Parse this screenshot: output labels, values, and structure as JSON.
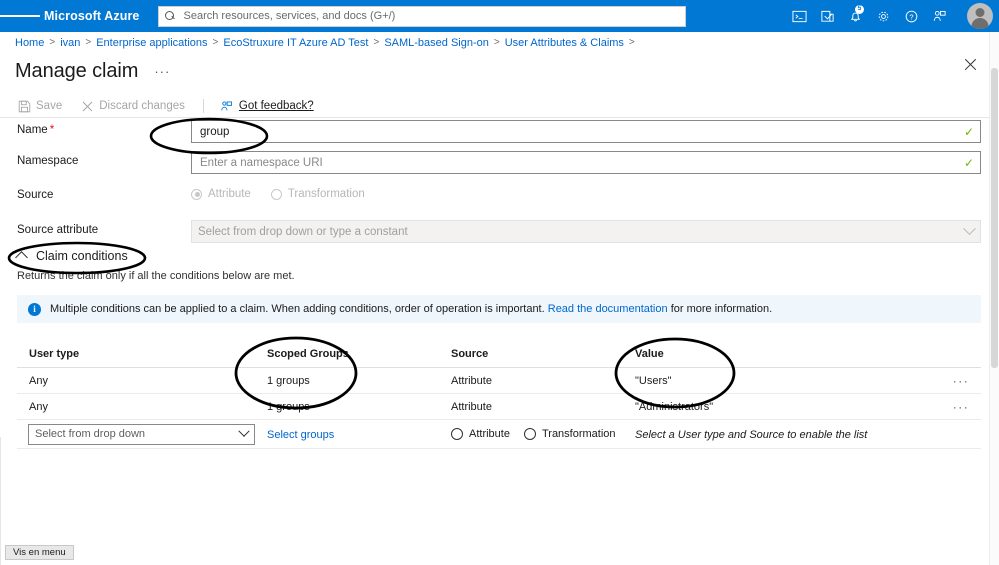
{
  "topbar": {
    "menu_icon": "hamburger-icon",
    "brand": "Microsoft Azure",
    "search": {
      "placeholder": "Search resources, services, and docs (G+/)",
      "value": "",
      "icon": "search-icon"
    },
    "icons": [
      {
        "name": "cloud-shell-icon",
        "glyph": ">_"
      },
      {
        "name": "directories-subscriptions-icon",
        "glyph": "directory"
      },
      {
        "name": "notifications-bell-icon",
        "glyph": "bell",
        "badge": "5"
      },
      {
        "name": "settings-gear-icon",
        "glyph": "gear"
      },
      {
        "name": "help-question-icon",
        "glyph": "?"
      },
      {
        "name": "feedback-person-icon",
        "glyph": "feedback"
      }
    ],
    "avatar": "user-avatar"
  },
  "breadcrumb": {
    "separator": ">",
    "items": [
      "Home",
      "ivan",
      "Enterprise applications",
      "EcoStruxure IT Azure AD Test",
      "SAML-based Sign-on",
      "User Attributes & Claims"
    ]
  },
  "header": {
    "title": "Manage claim",
    "more_label": "···",
    "close_label": "✕"
  },
  "toolbar": {
    "save_label": "Save",
    "discard_label": "Discard changes",
    "feedback_label": "Got feedback?"
  },
  "form": {
    "name": {
      "label": "Name",
      "required_mark": "*",
      "value": "group",
      "placeholder": "",
      "valid_mark": "✓"
    },
    "namespace": {
      "label": "Namespace",
      "value": "",
      "placeholder": "Enter a namespace URI",
      "valid_mark": "✓"
    },
    "source": {
      "label": "Source",
      "options": [
        "Attribute",
        "Transformation"
      ],
      "selected": "Attribute"
    },
    "source_attribute": {
      "label": "Source attribute",
      "placeholder": "Select from drop down or type a constant",
      "value": ""
    }
  },
  "claim_conditions": {
    "section_title": "Claim conditions",
    "section_subtitle": "Returns the claim only if all the conditions below are met.",
    "banner": {
      "icon": "info-icon",
      "text_before": "Multiple conditions can be applied to a claim.  When adding conditions, order of operation is important.",
      "link_text": "Read the documentation",
      "text_after": "for more information."
    },
    "table": {
      "columns": [
        "User type",
        "Scoped Groups",
        "Source",
        "Value",
        ""
      ],
      "rows": [
        {
          "user_type": "Any",
          "scoped_groups": "1 groups",
          "source": "Attribute",
          "value": "\"Users\"",
          "menu": "···"
        },
        {
          "user_type": "Any",
          "scoped_groups": "1 groups",
          "source": "Attribute",
          "value": "\"Administrators\"",
          "menu": "···"
        }
      ],
      "editor_row": {
        "user_type_placeholder": "Select from drop down",
        "select_groups_link": "Select groups",
        "source_options": [
          "Attribute",
          "Transformation"
        ],
        "value_hint": "Select a User type and Source to enable the list"
      }
    }
  },
  "footer": {
    "show_menu_button": "Vis en menu"
  },
  "colors": {
    "azure_blue": "#0078d4",
    "link_blue": "#0066cc",
    "banner_bg": "#eff6fc",
    "valid_green": "#6bb700",
    "required_red": "#e81123",
    "disabled_gray": "#a19f9d"
  }
}
